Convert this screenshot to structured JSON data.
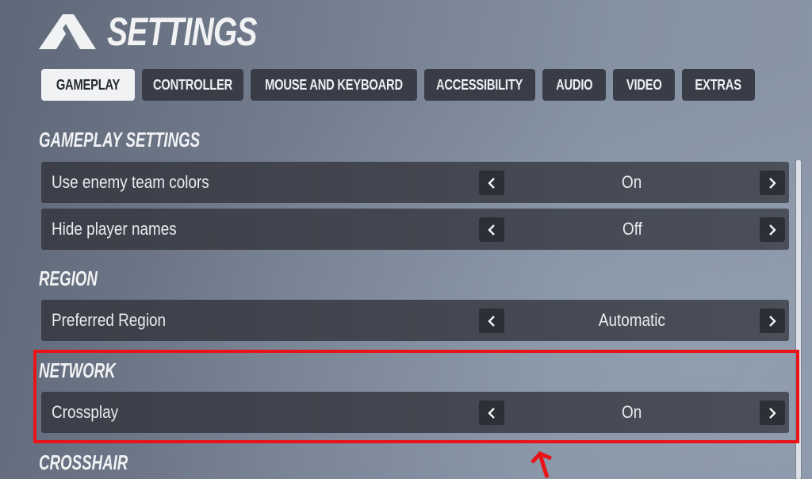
{
  "header": {
    "logo_icon": "game-logo-icon",
    "title": "SETTINGS"
  },
  "tabs": [
    {
      "label": "GAMEPLAY",
      "active": true
    },
    {
      "label": "CONTROLLER",
      "active": false
    },
    {
      "label": "MOUSE AND KEYBOARD",
      "active": false
    },
    {
      "label": "ACCESSIBILITY",
      "active": false
    },
    {
      "label": "AUDIO",
      "active": false
    },
    {
      "label": "VIDEO",
      "active": false
    },
    {
      "label": "EXTRAS",
      "active": false
    }
  ],
  "sections": {
    "gameplay": {
      "title": "GAMEPLAY SETTINGS",
      "rows": [
        {
          "label": "Use enemy team colors",
          "value": "On"
        },
        {
          "label": "Hide player names",
          "value": "Off"
        }
      ]
    },
    "region": {
      "title": "REGION",
      "rows": [
        {
          "label": "Preferred Region",
          "value": "Automatic"
        }
      ]
    },
    "network": {
      "title": "NETWORK",
      "rows": [
        {
          "label": "Crossplay",
          "value": "On"
        }
      ]
    },
    "crosshair": {
      "title": "CROSSHAIR"
    }
  },
  "icons": {
    "prev": "chevron-left-icon",
    "next": "chevron-right-icon"
  },
  "annotation": {
    "color": "#e8141a",
    "target": "network-section"
  },
  "colors": {
    "tab_active_bg": "#f1f2f4",
    "tab_bg": "#3a3d47",
    "row_bg": "#41444e",
    "arrow_btn_bg": "#2d2f37"
  }
}
